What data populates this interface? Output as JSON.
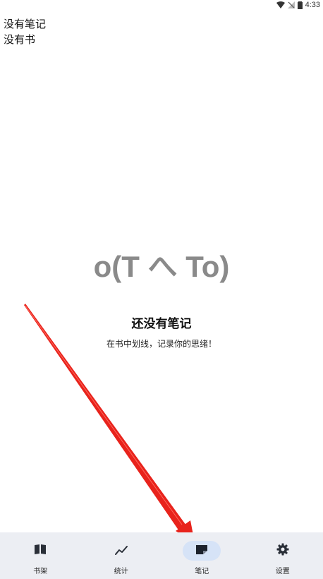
{
  "status_bar": {
    "time": "4:33",
    "icons": [
      "wifi-icon",
      "signal-icon",
      "battery-icon"
    ]
  },
  "header_lines": [
    "没有笔记",
    "没有书"
  ],
  "empty_state": {
    "face": "o(T へ To)",
    "title": "还没有笔记",
    "subtitle": "在书中划线，记录你的思绪！"
  },
  "bottom_nav": {
    "items": [
      {
        "label": "书架",
        "icon": "book-icon",
        "active": false
      },
      {
        "label": "统计",
        "icon": "trend-icon",
        "active": false
      },
      {
        "label": "笔记",
        "icon": "note-icon",
        "active": true
      },
      {
        "label": "设置",
        "icon": "gear-icon",
        "active": false
      }
    ]
  },
  "annotation_color": "#e8231c",
  "active_nav_color": "#d6e3f7"
}
